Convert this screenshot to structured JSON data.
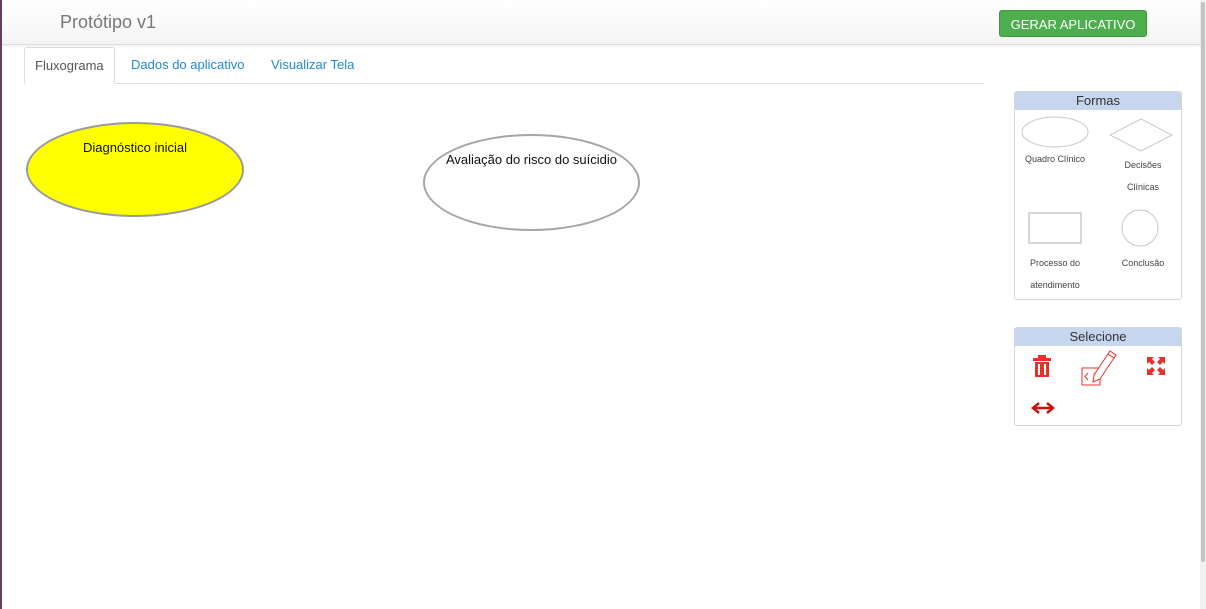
{
  "app": {
    "title": "Protótipo v1",
    "generate_button": "GERAR APLICATIVO"
  },
  "tabs": [
    {
      "label": "Fluxograma",
      "active": true
    },
    {
      "label": "Dados do aplicativo",
      "active": false
    },
    {
      "label": "Visualizar Tela",
      "active": false
    }
  ],
  "canvas": {
    "nodes": [
      {
        "label": "Diagnóstico inicial",
        "shape": "ellipse",
        "fill": "#ffff00"
      },
      {
        "label": "Avaliação do risco do suícidio",
        "shape": "ellipse",
        "fill": "#ffffff"
      }
    ]
  },
  "panels": {
    "formas": {
      "title": "Formas",
      "shapes": [
        {
          "icon": "ellipse-shape-icon",
          "label_lines": [
            "Quadro Clínico"
          ]
        },
        {
          "icon": "diamond-shape-icon",
          "label_lines": [
            "Decisões",
            "Clínicas"
          ]
        },
        {
          "icon": "rectangle-shape-icon",
          "label_lines": [
            "Processo do",
            "atendimento"
          ]
        },
        {
          "icon": "circle-shape-icon",
          "label_lines": [
            "Conclusão"
          ]
        }
      ]
    },
    "selecione": {
      "title": "Selecione",
      "tools": [
        "trash-icon",
        "edit-code-icon",
        "expand-icon",
        "horizontal-arrows-icon"
      ]
    }
  },
  "colors": {
    "accent_green": "#4cae4c",
    "link_blue": "#1f8ad4",
    "panel_header": "#c5d6ee",
    "tool_red": "#e8312b",
    "node_yellow": "#ffff00"
  }
}
